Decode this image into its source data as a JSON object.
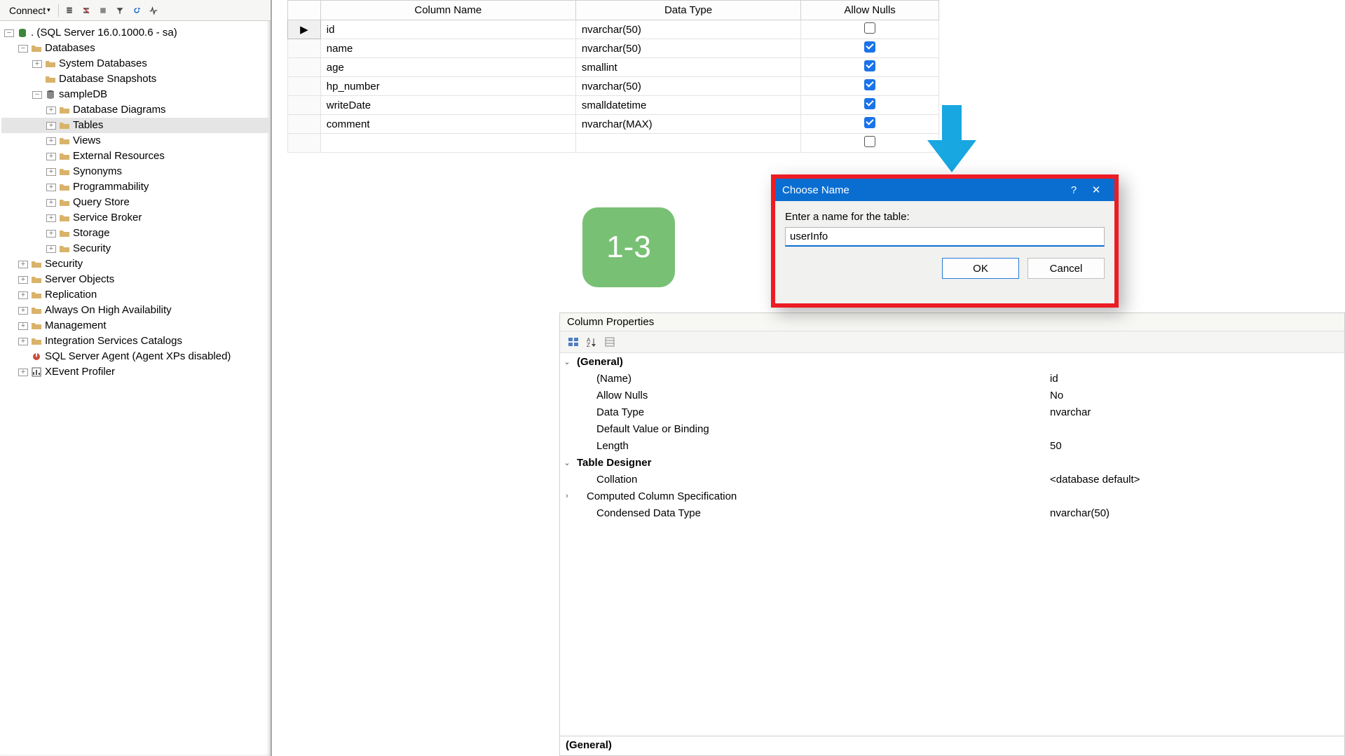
{
  "toolbar": {
    "connect_label": "Connect"
  },
  "tree": {
    "server_label": ". (SQL Server 16.0.1000.6 - sa)",
    "databases_label": "Databases",
    "system_db_label": "System Databases",
    "snapshots_label": "Database Snapshots",
    "sampledb_label": "sampleDB",
    "db_diagrams_label": "Database Diagrams",
    "tables_label": "Tables",
    "views_label": "Views",
    "ext_res_label": "External Resources",
    "synonyms_label": "Synonyms",
    "programmability_label": "Programmability",
    "query_store_label": "Query Store",
    "service_broker_label": "Service Broker",
    "storage_label": "Storage",
    "security_db_label": "Security",
    "security_label": "Security",
    "server_objects_label": "Server Objects",
    "replication_label": "Replication",
    "always_on_label": "Always On High Availability",
    "management_label": "Management",
    "isc_label": "Integration Services Catalogs",
    "agent_label": "SQL Server Agent (Agent XPs disabled)",
    "xevent_label": "XEvent Profiler"
  },
  "grid": {
    "header_col": "Column Name",
    "header_type": "Data Type",
    "header_nulls": "Allow Nulls",
    "rows": [
      {
        "name": "id",
        "type": "nvarchar(50)",
        "nulls": false
      },
      {
        "name": "name",
        "type": "nvarchar(50)",
        "nulls": true
      },
      {
        "name": "age",
        "type": "smallint",
        "nulls": true
      },
      {
        "name": "hp_number",
        "type": "nvarchar(50)",
        "nulls": true
      },
      {
        "name": "writeDate",
        "type": "smalldatetime",
        "nulls": true
      },
      {
        "name": "comment",
        "type": "nvarchar(MAX)",
        "nulls": true
      }
    ]
  },
  "step": {
    "label": "1-3"
  },
  "dialog": {
    "title": "Choose Name",
    "prompt": "Enter a name for the table:",
    "value": "userInfo",
    "ok": "OK",
    "cancel": "Cancel"
  },
  "props": {
    "header": "Column Properties",
    "general_label": "(General)",
    "name_label": "(Name)",
    "name_value": "id",
    "allow_nulls_label": "Allow Nulls",
    "allow_nulls_value": "No",
    "data_type_label": "Data Type",
    "data_type_value": "nvarchar",
    "default_label": "Default Value or Binding",
    "length_label": "Length",
    "length_value": "50",
    "designer_label": "Table Designer",
    "collation_label": "Collation",
    "collation_value": "<database default>",
    "computed_label": "Computed Column Specification",
    "condensed_label": "Condensed Data Type",
    "condensed_value": "nvarchar(50)",
    "footer": "(General)"
  }
}
